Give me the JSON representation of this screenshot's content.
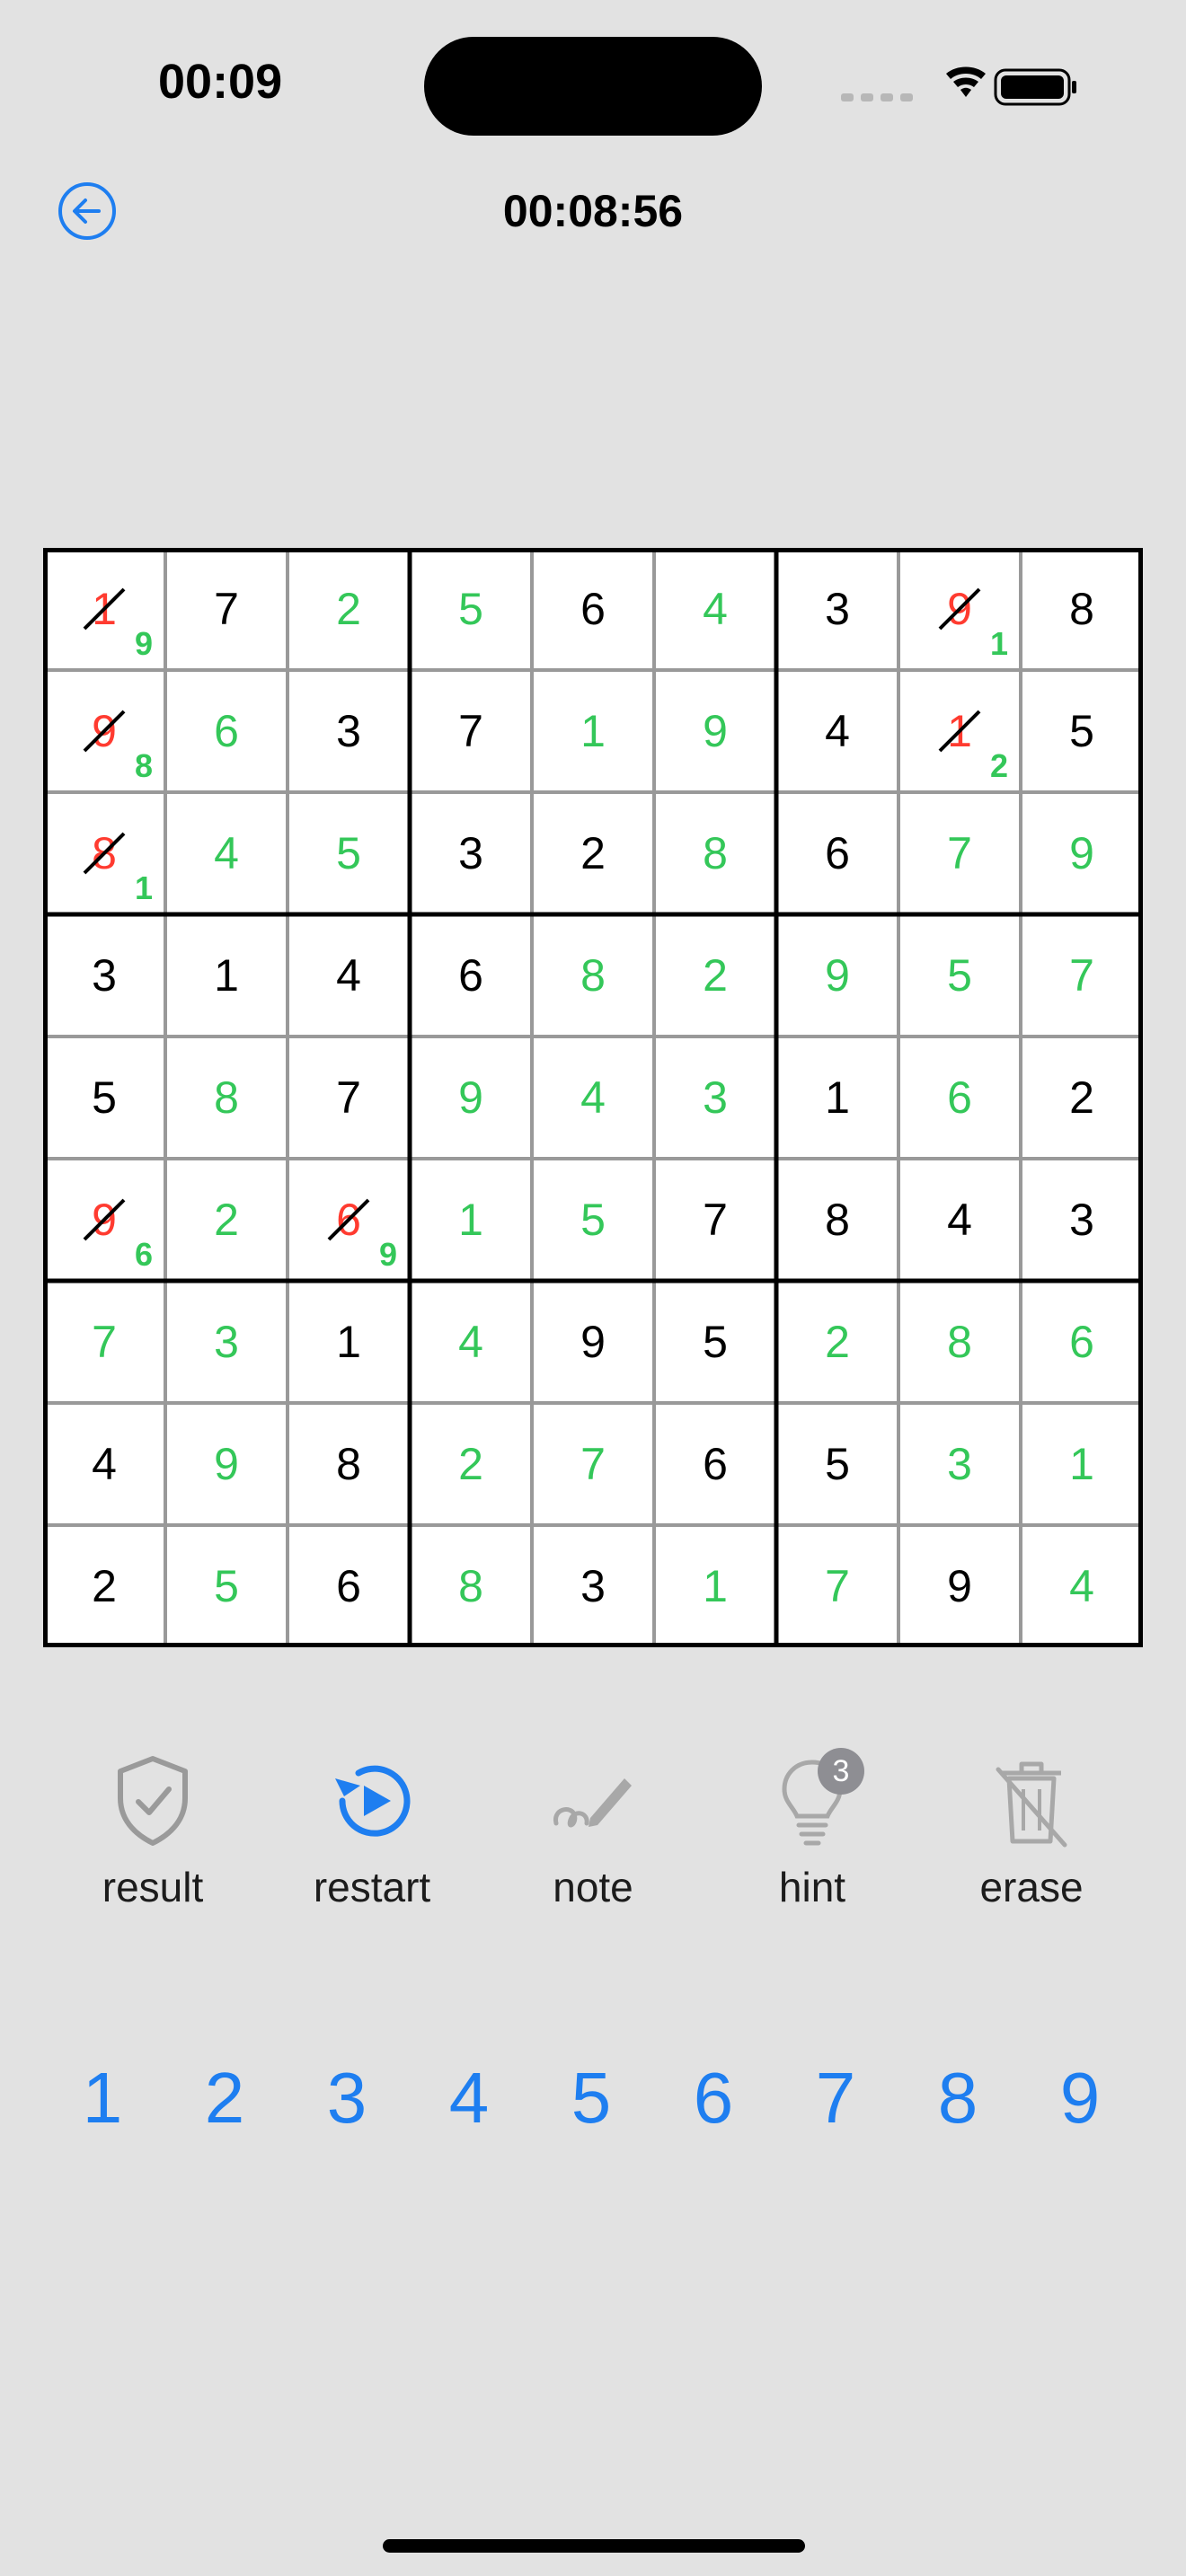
{
  "status": {
    "time": "00:09"
  },
  "header": {
    "timer": "00:08:56"
  },
  "colors": {
    "accent": "#1e7ef0",
    "user_entry": "#34c759",
    "error": "#ff3b30",
    "given": "#000000"
  },
  "board": {
    "rows": [
      [
        {
          "v": "",
          "wrong": "1",
          "note": "9"
        },
        {
          "v": "7",
          "t": "g"
        },
        {
          "v": "2",
          "t": "u"
        },
        {
          "v": "5",
          "t": "u"
        },
        {
          "v": "6",
          "t": "g"
        },
        {
          "v": "4",
          "t": "u"
        },
        {
          "v": "3",
          "t": "g"
        },
        {
          "v": "",
          "wrong": "9",
          "note": "1"
        },
        {
          "v": "8",
          "t": "g"
        }
      ],
      [
        {
          "v": "",
          "wrong": "9",
          "note": "8"
        },
        {
          "v": "6",
          "t": "u"
        },
        {
          "v": "3",
          "t": "g"
        },
        {
          "v": "7",
          "t": "g"
        },
        {
          "v": "1",
          "t": "u"
        },
        {
          "v": "9",
          "t": "u"
        },
        {
          "v": "4",
          "t": "g"
        },
        {
          "v": "",
          "wrong": "1",
          "note": "2"
        },
        {
          "v": "5",
          "t": "g"
        }
      ],
      [
        {
          "v": "",
          "wrong": "8",
          "note": "1"
        },
        {
          "v": "4",
          "t": "u"
        },
        {
          "v": "5",
          "t": "u"
        },
        {
          "v": "3",
          "t": "g"
        },
        {
          "v": "2",
          "t": "g"
        },
        {
          "v": "8",
          "t": "u"
        },
        {
          "v": "6",
          "t": "g"
        },
        {
          "v": "7",
          "t": "u"
        },
        {
          "v": "9",
          "t": "u"
        }
      ],
      [
        {
          "v": "3",
          "t": "g"
        },
        {
          "v": "1",
          "t": "g"
        },
        {
          "v": "4",
          "t": "g"
        },
        {
          "v": "6",
          "t": "g"
        },
        {
          "v": "8",
          "t": "u"
        },
        {
          "v": "2",
          "t": "u"
        },
        {
          "v": "9",
          "t": "u"
        },
        {
          "v": "5",
          "t": "u"
        },
        {
          "v": "7",
          "t": "u"
        }
      ],
      [
        {
          "v": "5",
          "t": "g"
        },
        {
          "v": "8",
          "t": "u"
        },
        {
          "v": "7",
          "t": "g"
        },
        {
          "v": "9",
          "t": "u"
        },
        {
          "v": "4",
          "t": "u"
        },
        {
          "v": "3",
          "t": "u"
        },
        {
          "v": "1",
          "t": "g"
        },
        {
          "v": "6",
          "t": "u"
        },
        {
          "v": "2",
          "t": "g"
        }
      ],
      [
        {
          "v": "",
          "wrong": "9",
          "note": "6"
        },
        {
          "v": "2",
          "t": "u"
        },
        {
          "v": "",
          "wrong": "6",
          "note": "9"
        },
        {
          "v": "1",
          "t": "u"
        },
        {
          "v": "5",
          "t": "u"
        },
        {
          "v": "7",
          "t": "g"
        },
        {
          "v": "8",
          "t": "g"
        },
        {
          "v": "4",
          "t": "g"
        },
        {
          "v": "3",
          "t": "g"
        }
      ],
      [
        {
          "v": "7",
          "t": "u"
        },
        {
          "v": "3",
          "t": "u"
        },
        {
          "v": "1",
          "t": "g"
        },
        {
          "v": "4",
          "t": "u"
        },
        {
          "v": "9",
          "t": "g"
        },
        {
          "v": "5",
          "t": "g"
        },
        {
          "v": "2",
          "t": "u"
        },
        {
          "v": "8",
          "t": "u"
        },
        {
          "v": "6",
          "t": "u"
        }
      ],
      [
        {
          "v": "4",
          "t": "g"
        },
        {
          "v": "9",
          "t": "u"
        },
        {
          "v": "8",
          "t": "g"
        },
        {
          "v": "2",
          "t": "u"
        },
        {
          "v": "7",
          "t": "u"
        },
        {
          "v": "6",
          "t": "g"
        },
        {
          "v": "5",
          "t": "g"
        },
        {
          "v": "3",
          "t": "u"
        },
        {
          "v": "1",
          "t": "u"
        }
      ],
      [
        {
          "v": "2",
          "t": "g"
        },
        {
          "v": "5",
          "t": "u"
        },
        {
          "v": "6",
          "t": "g"
        },
        {
          "v": "8",
          "t": "u"
        },
        {
          "v": "3",
          "t": "g"
        },
        {
          "v": "1",
          "t": "u"
        },
        {
          "v": "7",
          "t": "u"
        },
        {
          "v": "9",
          "t": "g"
        },
        {
          "v": "4",
          "t": "u"
        }
      ]
    ]
  },
  "toolbar": {
    "result_label": "result",
    "restart_label": "restart",
    "note_label": "note",
    "hint_label": "hint",
    "hint_count": "3",
    "erase_label": "erase"
  },
  "numpad": [
    "1",
    "2",
    "3",
    "4",
    "5",
    "6",
    "7",
    "8",
    "9"
  ]
}
